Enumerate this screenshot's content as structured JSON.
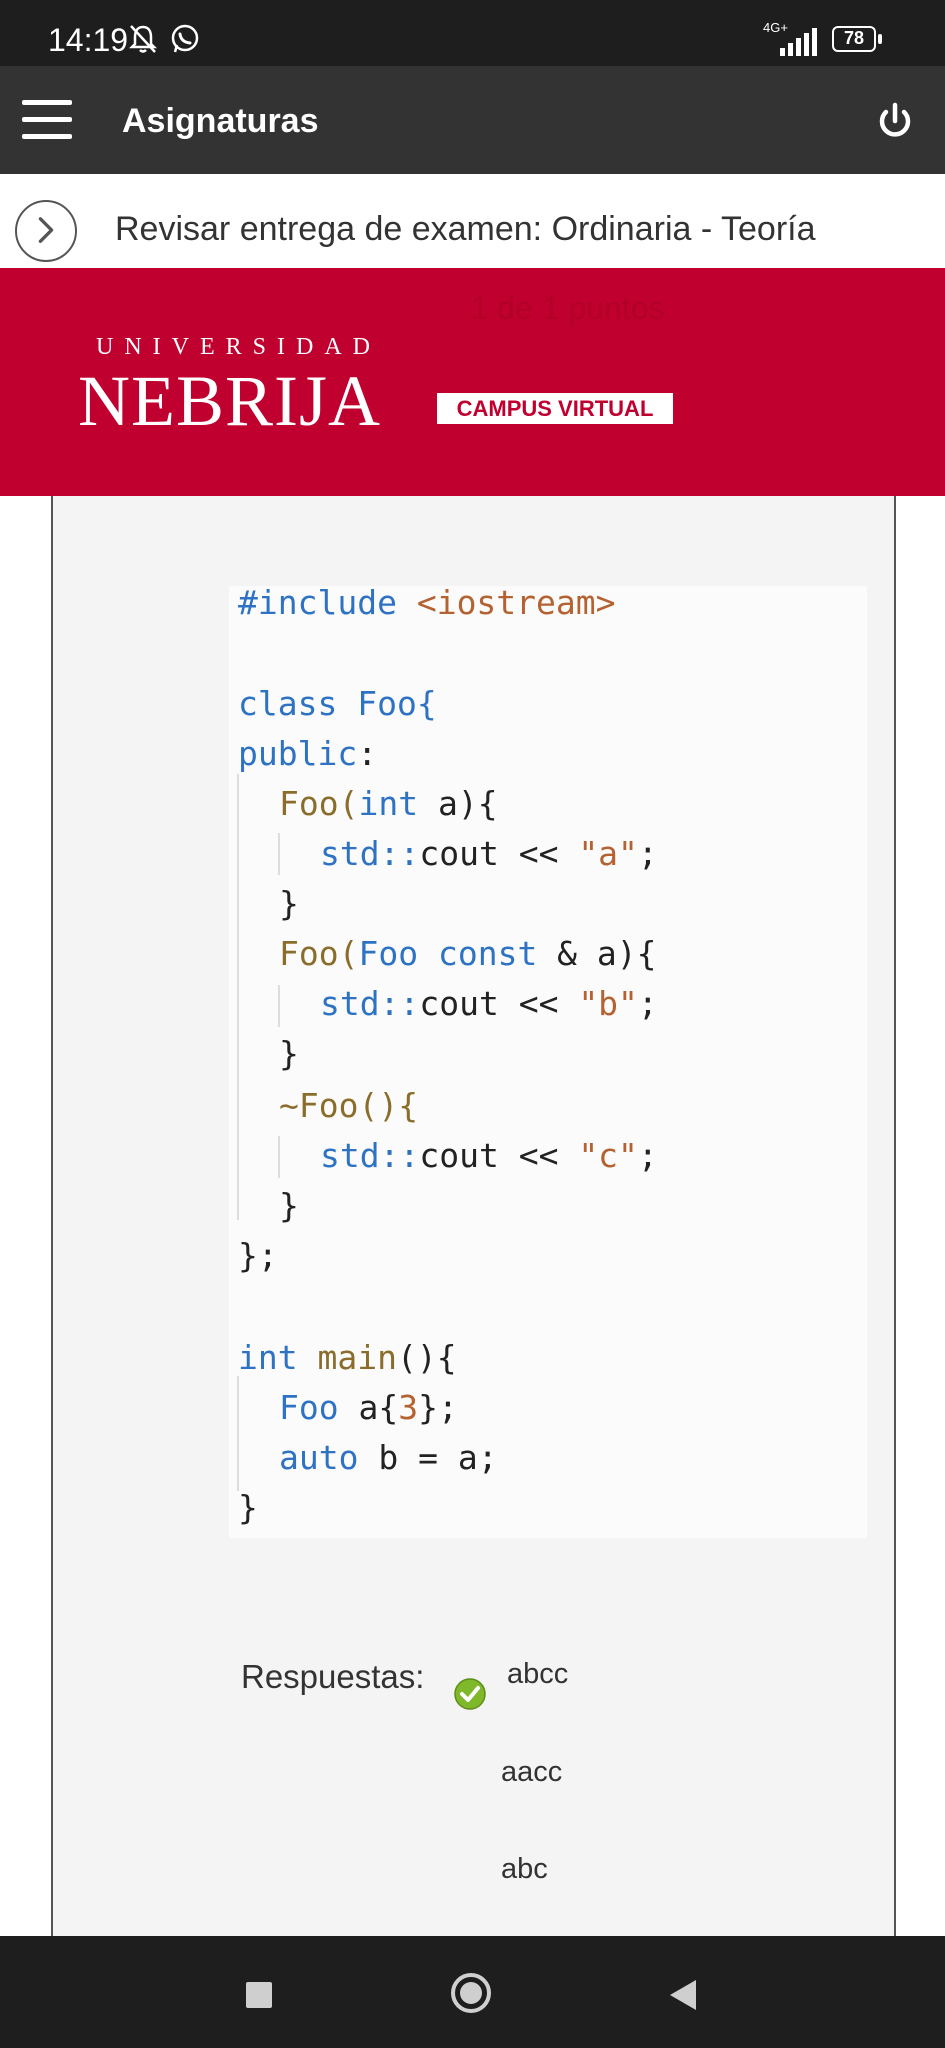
{
  "status_bar": {
    "time": "14:19",
    "network": "4G+",
    "battery": "78",
    "icons": [
      "bell-off-icon",
      "whatsapp-icon",
      "signal-icon",
      "battery-icon"
    ]
  },
  "app_bar": {
    "title": "Asignaturas",
    "icons": [
      "menu-icon",
      "power-icon"
    ]
  },
  "breadcrumb": {
    "text": "Revisar entrega de examen: Ordinaria - Teoría",
    "icon": "chevron-right-icon"
  },
  "banner": {
    "points": "1 de 1 puntos",
    "university": "UNIVERSIDAD",
    "name": "NEBRIJA",
    "campus": "CAMPUS VIRTUAL",
    "color": "#c0002f"
  },
  "code": {
    "include_kw": "#include",
    "include_hdr": "<iostream>",
    "class_kw": "class",
    "class_name": "Foo{",
    "public_kw": "public",
    "public_colon": ":",
    "ctor1_name": "Foo(",
    "ctor1_kw": "int",
    "ctor1_rest": " a){",
    "cout_ns": "std::",
    "cout_name": "cout",
    "cout_op": " << ",
    "str_a": "\"a\"",
    "str_b": "\"b\"",
    "str_c": "\"c\"",
    "semicolon": ";",
    "close_brace": "}",
    "ctor2_name": "Foo(",
    "ctor2_type": "Foo",
    "ctor2_const": "const",
    "ctor2_rest": " & a){",
    "dtor": "~Foo(){",
    "class_end": "};",
    "main_kw": "int",
    "main_name": "main",
    "main_rest": "(){",
    "foo_type": "Foo",
    "foo_decl": " a{",
    "foo_num": "3",
    "foo_end": "};",
    "auto_kw": "auto",
    "auto_rest": " b = a;",
    "main_end": "}"
  },
  "answers": {
    "label": "Respuestas:",
    "options": [
      "abcc",
      "aacc",
      "abc"
    ],
    "correct_icon": "check-circle-icon",
    "correct_color": "#7fb82a"
  },
  "nav_bar": {
    "icons": [
      "square-icon",
      "home-circle-icon",
      "back-triangle-icon"
    ]
  }
}
